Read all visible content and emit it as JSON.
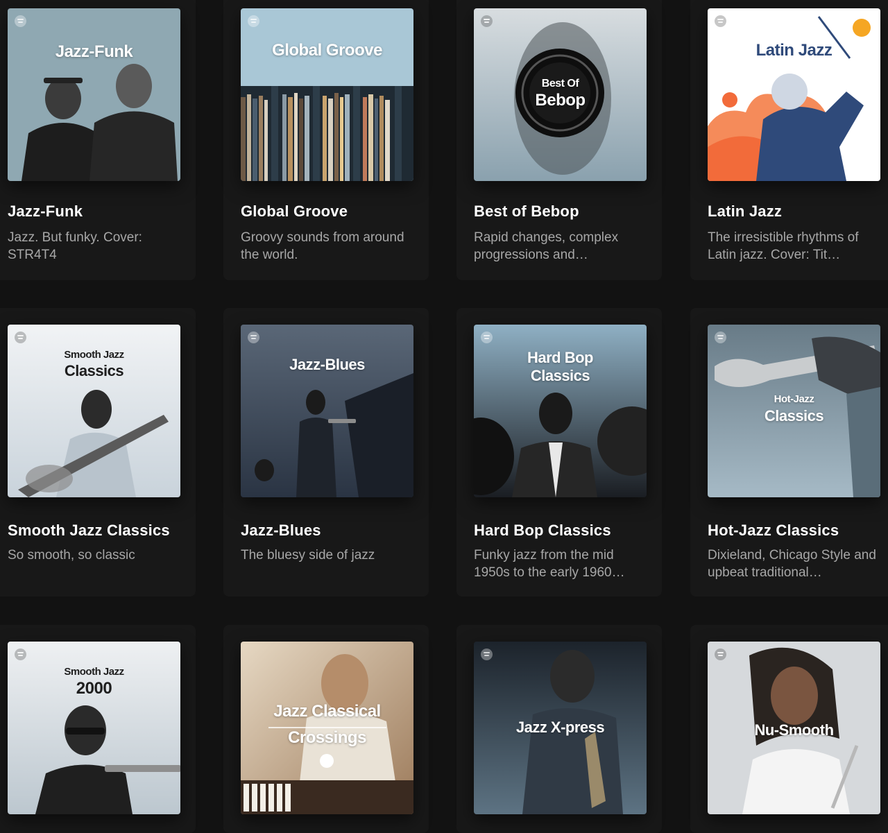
{
  "playlists": [
    {
      "title": "Jazz-Funk",
      "description": "Jazz. But funky. Cover: STR4T4",
      "cover_text": [
        "Jazz-Funk"
      ],
      "cover_bg": "#8fa8b2"
    },
    {
      "title": "Global Groove",
      "description": "Groovy sounds from around the world.",
      "cover_text": [
        "Global Groove"
      ],
      "cover_bg": "#a9c7d6"
    },
    {
      "title": "Best of Bebop",
      "description": "Rapid changes, complex progressions and…",
      "cover_text": [
        "Best Of",
        "Bebop"
      ],
      "cover_bg": "#b4c3cc"
    },
    {
      "title": "Latin Jazz",
      "description": "The irresistible rhythms of Latin jazz. Cover: Tit…",
      "cover_text": [
        "Latin Jazz"
      ],
      "cover_bg": "#ffffff"
    },
    {
      "title": "Smooth Jazz Classics",
      "description": "So smooth, so classic",
      "cover_text": [
        "Smooth Jazz",
        "Classics"
      ],
      "cover_bg": "#e6eaee"
    },
    {
      "title": "Jazz-Blues",
      "description": "The bluesy side of jazz",
      "cover_text": [
        "Jazz-Blues"
      ],
      "cover_bg": "#39475a"
    },
    {
      "title": "Hard Bop Classics",
      "description": "Funky jazz from the mid 1950s to the early 1960…",
      "cover_text": [
        "Hard Bop",
        "Classics"
      ],
      "cover_bg": "#7f9cb0"
    },
    {
      "title": "Hot-Jazz Classics",
      "description": "Dixieland, Chicago Style and upbeat traditional…",
      "cover_text": [
        "Hot-Jazz",
        "Classics"
      ],
      "cover_bg": "#8ea4b2"
    },
    {
      "title": "",
      "description": "",
      "cover_text": [
        "Smooth Jazz",
        "2000"
      ],
      "cover_bg": "#d9dee2"
    },
    {
      "title": "",
      "description": "",
      "cover_text": [
        "Jazz Classical",
        "Crossings"
      ],
      "cover_bg": "#d8c6b0"
    },
    {
      "title": "",
      "description": "",
      "cover_text": [
        "Jazz X-press"
      ],
      "cover_bg": "#2e3b49"
    },
    {
      "title": "",
      "description": "",
      "cover_text": [
        "Nu-Smooth"
      ],
      "cover_bg": "#d6d9dc"
    }
  ]
}
